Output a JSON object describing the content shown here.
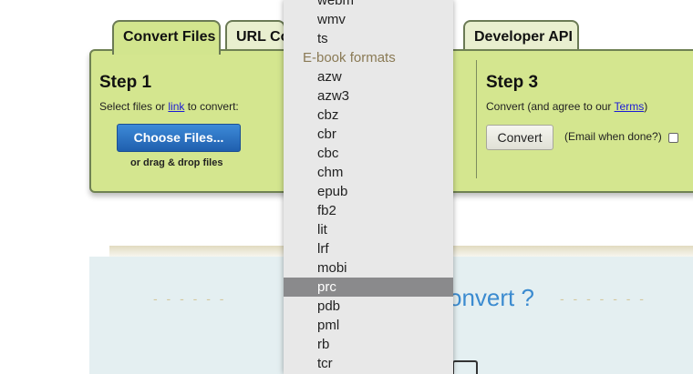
{
  "tabs": [
    {
      "label": "Convert Files",
      "active": true
    },
    {
      "label": "URL Co",
      "active": false
    },
    {
      "label": "Developer API",
      "active": false
    }
  ],
  "step1": {
    "title": "Step 1",
    "instruction_prefix": "Select files or ",
    "instruction_link": "link",
    "instruction_suffix": " to convert:",
    "choose_button": "Choose Files...",
    "drag_text": "or drag & drop files"
  },
  "step3": {
    "title": "Step 3",
    "instruction_prefix": "Convert (and agree to our ",
    "terms_link": "Terms",
    "instruction_suffix": ")",
    "convert_button": "Convert",
    "email_label": "(Email when done?)",
    "email_checked": false
  },
  "lower": {
    "dashes_left": "- - - - - -",
    "dashes_right": "- - - - - - -",
    "heading_fragment": "onvert ?"
  },
  "dropdown": {
    "video_items": [
      "webm",
      "wmv",
      "ts"
    ],
    "group_label": "E-book formats",
    "ebook_items": [
      "azw",
      "azw3",
      "cbz",
      "cbr",
      "cbc",
      "chm",
      "epub",
      "fb2",
      "lit",
      "lrf",
      "mobi",
      "prc",
      "pdb",
      "pml",
      "rb",
      "tcr"
    ],
    "selected": "prc"
  },
  "colors": {
    "panel": "#d4e68f",
    "active_tab": "#d2e58e",
    "choose_button": "#2f74c4",
    "heading_blue": "#3b8bd0",
    "dropdown_bg": "#e8e8e8",
    "selected_bg": "#8a8a8c"
  }
}
